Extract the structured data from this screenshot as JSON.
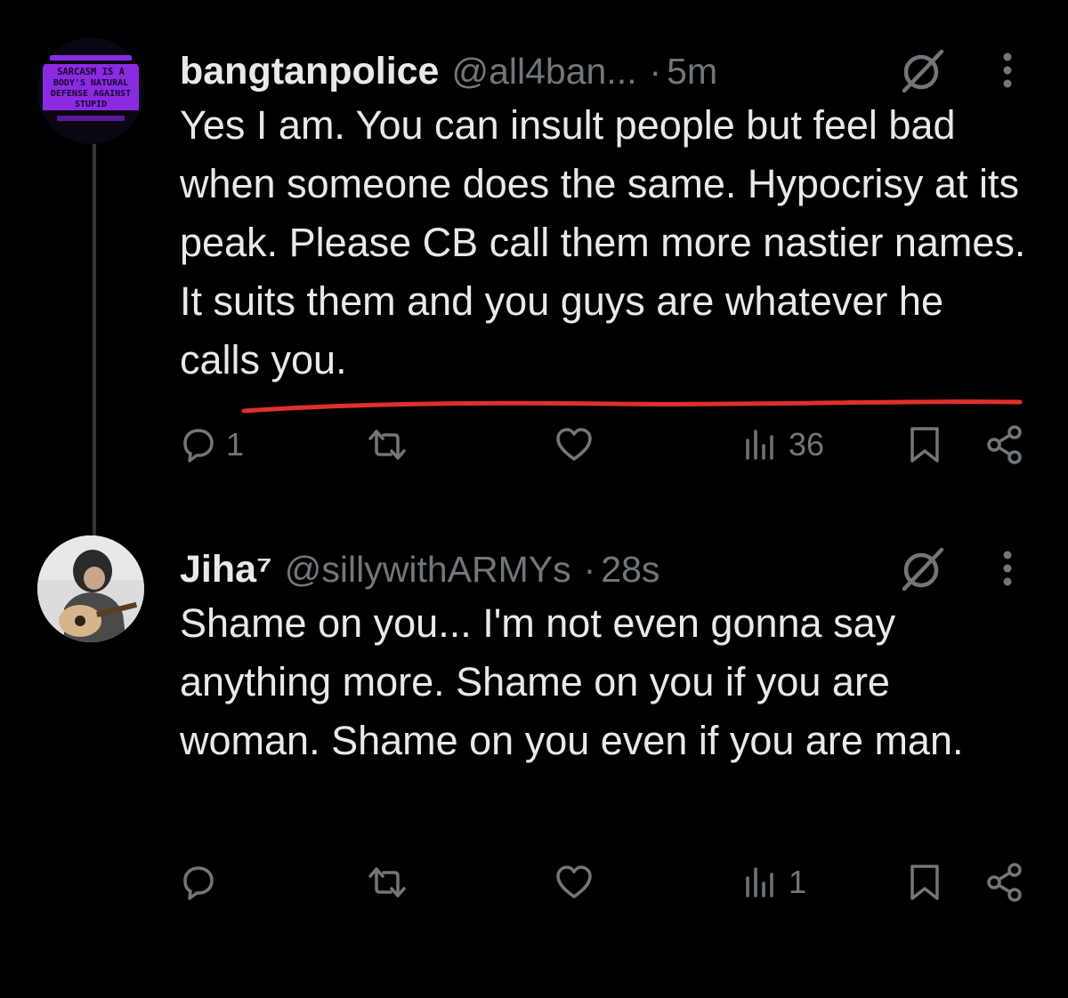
{
  "tweets": [
    {
      "avatar_text": [
        "SARCASM IS A",
        "BODY'S NATURAL",
        "DEFENSE AGAINST",
        "STUPID"
      ],
      "display_name": "bangtanpolice",
      "handle": "@all4ban...",
      "separator": "·",
      "time": "5m",
      "text": "Yes I am. You can insult people but feel bad when someone does the same. Hypocrisy at its peak. Please CB call them more nastier names. It suits them and you guys are whatever he calls you.",
      "reply_count": "1",
      "views_count": "36"
    },
    {
      "display_name": "Jiha⁷",
      "handle": "@sillywithARMYs",
      "separator": "·",
      "time": "28s",
      "text": "Shame on you... I'm not even gonna say anything more. Shame on you if you are woman. Shame on you even if you are man.",
      "reply_count": "",
      "views_count": "1"
    }
  ],
  "colors": {
    "background": "#000000",
    "text_primary": "#e7e9ea",
    "text_secondary": "#71767b",
    "underline": "#e0302a",
    "avatar_purple": "#8a2be2"
  },
  "icons": [
    "reply-icon",
    "retweet-icon",
    "like-icon",
    "views-icon",
    "bookmark-icon",
    "share-icon",
    "grok-icon",
    "more-icon"
  ]
}
